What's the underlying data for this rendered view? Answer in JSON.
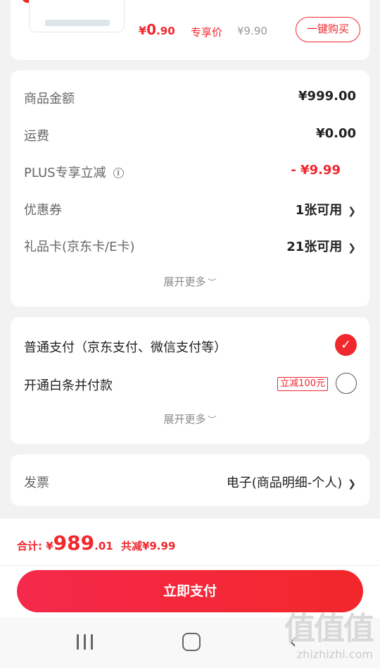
{
  "product_card": {
    "price_symbol": "¥",
    "price_int": "0",
    "price_dec": ".90",
    "exclusive_label": "专享价",
    "original_price": "¥9.90",
    "buy_button": "一键购买"
  },
  "summary": {
    "rows": [
      {
        "label": "商品金额",
        "value": "¥999.00"
      },
      {
        "label": "运费",
        "value": "¥0.00"
      },
      {
        "label": "PLUS专享立减",
        "value": "- ¥9.99"
      },
      {
        "label": "优惠券",
        "value": "1张可用"
      },
      {
        "label": "礼品卡(京东卡/E卡)",
        "value": "21张可用"
      }
    ],
    "expand_label": "展开更多"
  },
  "payment": {
    "options": [
      {
        "label": "普通支付（京东支付、微信支付等）",
        "selected": true
      },
      {
        "label": "开通白条并付款",
        "badge": "立减100元",
        "selected": false
      }
    ],
    "expand_label": "展开更多"
  },
  "invoice": {
    "label": "发票",
    "value": "电子(商品明细-个人)"
  },
  "footer": {
    "total_label": "合计: ¥",
    "total_int": "989",
    "total_dec": ".01",
    "saved_label": "共减¥9.99",
    "pay_button": "立即支付"
  },
  "watermark": {
    "logo": "值值值",
    "text": "zhizhizhi.com"
  },
  "colors": {
    "accent": "#f0272d",
    "background": "#f2f2f2"
  },
  "icons": [
    "info-icon",
    "chevron-right-icon",
    "chevron-down-icon",
    "check-icon",
    "recents-icon",
    "home-icon",
    "back-icon"
  ]
}
